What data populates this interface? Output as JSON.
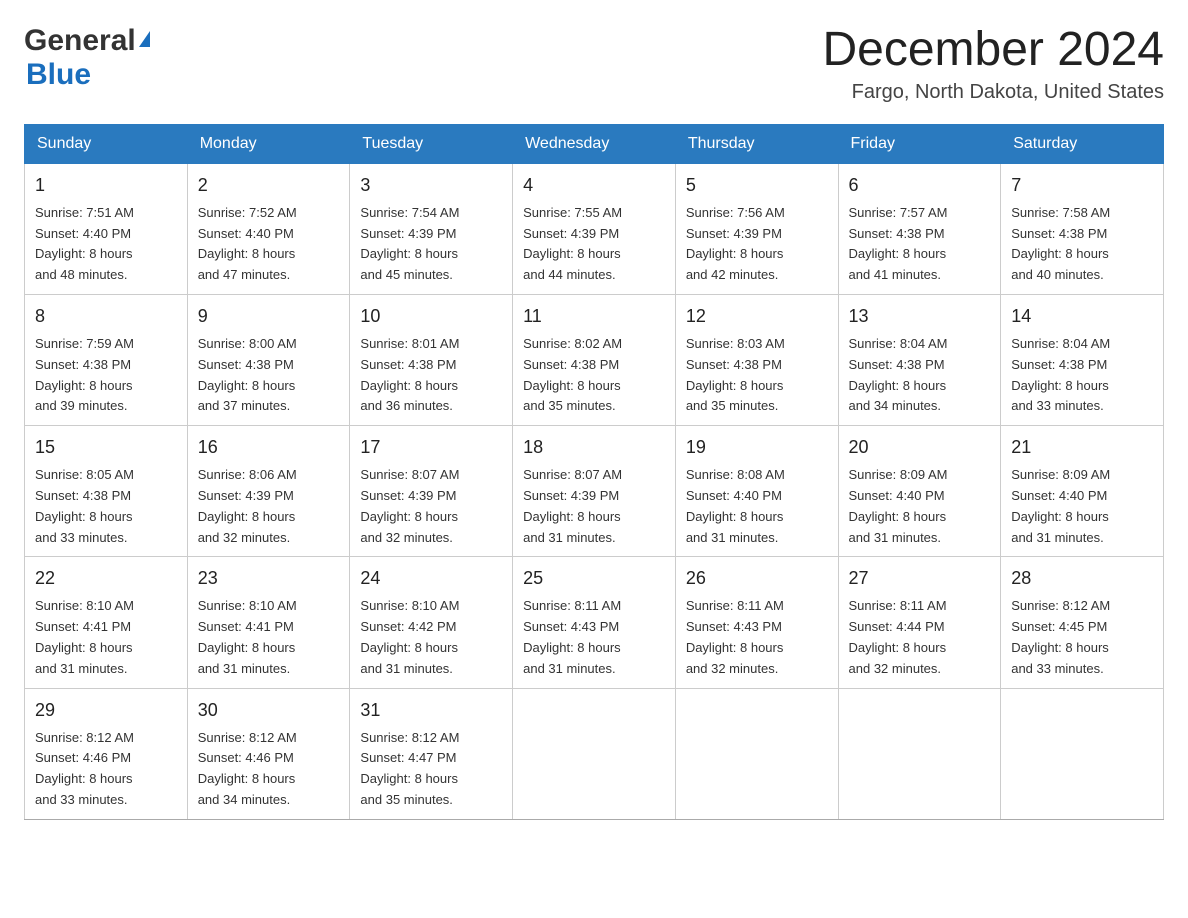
{
  "logo": {
    "text_general": "General",
    "text_blue": "Blue"
  },
  "title": "December 2024",
  "subtitle": "Fargo, North Dakota, United States",
  "days_of_week": [
    "Sunday",
    "Monday",
    "Tuesday",
    "Wednesday",
    "Thursday",
    "Friday",
    "Saturday"
  ],
  "weeks": [
    [
      {
        "day": "1",
        "sunrise": "7:51 AM",
        "sunset": "4:40 PM",
        "daylight": "8 hours and 48 minutes."
      },
      {
        "day": "2",
        "sunrise": "7:52 AM",
        "sunset": "4:40 PM",
        "daylight": "8 hours and 47 minutes."
      },
      {
        "day": "3",
        "sunrise": "7:54 AM",
        "sunset": "4:39 PM",
        "daylight": "8 hours and 45 minutes."
      },
      {
        "day": "4",
        "sunrise": "7:55 AM",
        "sunset": "4:39 PM",
        "daylight": "8 hours and 44 minutes."
      },
      {
        "day": "5",
        "sunrise": "7:56 AM",
        "sunset": "4:39 PM",
        "daylight": "8 hours and 42 minutes."
      },
      {
        "day": "6",
        "sunrise": "7:57 AM",
        "sunset": "4:38 PM",
        "daylight": "8 hours and 41 minutes."
      },
      {
        "day": "7",
        "sunrise": "7:58 AM",
        "sunset": "4:38 PM",
        "daylight": "8 hours and 40 minutes."
      }
    ],
    [
      {
        "day": "8",
        "sunrise": "7:59 AM",
        "sunset": "4:38 PM",
        "daylight": "8 hours and 39 minutes."
      },
      {
        "day": "9",
        "sunrise": "8:00 AM",
        "sunset": "4:38 PM",
        "daylight": "8 hours and 37 minutes."
      },
      {
        "day": "10",
        "sunrise": "8:01 AM",
        "sunset": "4:38 PM",
        "daylight": "8 hours and 36 minutes."
      },
      {
        "day": "11",
        "sunrise": "8:02 AM",
        "sunset": "4:38 PM",
        "daylight": "8 hours and 35 minutes."
      },
      {
        "day": "12",
        "sunrise": "8:03 AM",
        "sunset": "4:38 PM",
        "daylight": "8 hours and 35 minutes."
      },
      {
        "day": "13",
        "sunrise": "8:04 AM",
        "sunset": "4:38 PM",
        "daylight": "8 hours and 34 minutes."
      },
      {
        "day": "14",
        "sunrise": "8:04 AM",
        "sunset": "4:38 PM",
        "daylight": "8 hours and 33 minutes."
      }
    ],
    [
      {
        "day": "15",
        "sunrise": "8:05 AM",
        "sunset": "4:38 PM",
        "daylight": "8 hours and 33 minutes."
      },
      {
        "day": "16",
        "sunrise": "8:06 AM",
        "sunset": "4:39 PM",
        "daylight": "8 hours and 32 minutes."
      },
      {
        "day": "17",
        "sunrise": "8:07 AM",
        "sunset": "4:39 PM",
        "daylight": "8 hours and 32 minutes."
      },
      {
        "day": "18",
        "sunrise": "8:07 AM",
        "sunset": "4:39 PM",
        "daylight": "8 hours and 31 minutes."
      },
      {
        "day": "19",
        "sunrise": "8:08 AM",
        "sunset": "4:40 PM",
        "daylight": "8 hours and 31 minutes."
      },
      {
        "day": "20",
        "sunrise": "8:09 AM",
        "sunset": "4:40 PM",
        "daylight": "8 hours and 31 minutes."
      },
      {
        "day": "21",
        "sunrise": "8:09 AM",
        "sunset": "4:40 PM",
        "daylight": "8 hours and 31 minutes."
      }
    ],
    [
      {
        "day": "22",
        "sunrise": "8:10 AM",
        "sunset": "4:41 PM",
        "daylight": "8 hours and 31 minutes."
      },
      {
        "day": "23",
        "sunrise": "8:10 AM",
        "sunset": "4:41 PM",
        "daylight": "8 hours and 31 minutes."
      },
      {
        "day": "24",
        "sunrise": "8:10 AM",
        "sunset": "4:42 PM",
        "daylight": "8 hours and 31 minutes."
      },
      {
        "day": "25",
        "sunrise": "8:11 AM",
        "sunset": "4:43 PM",
        "daylight": "8 hours and 31 minutes."
      },
      {
        "day": "26",
        "sunrise": "8:11 AM",
        "sunset": "4:43 PM",
        "daylight": "8 hours and 32 minutes."
      },
      {
        "day": "27",
        "sunrise": "8:11 AM",
        "sunset": "4:44 PM",
        "daylight": "8 hours and 32 minutes."
      },
      {
        "day": "28",
        "sunrise": "8:12 AM",
        "sunset": "4:45 PM",
        "daylight": "8 hours and 33 minutes."
      }
    ],
    [
      {
        "day": "29",
        "sunrise": "8:12 AM",
        "sunset": "4:46 PM",
        "daylight": "8 hours and 33 minutes."
      },
      {
        "day": "30",
        "sunrise": "8:12 AM",
        "sunset": "4:46 PM",
        "daylight": "8 hours and 34 minutes."
      },
      {
        "day": "31",
        "sunrise": "8:12 AM",
        "sunset": "4:47 PM",
        "daylight": "8 hours and 35 minutes."
      },
      null,
      null,
      null,
      null
    ]
  ],
  "labels": {
    "sunrise": "Sunrise:",
    "sunset": "Sunset:",
    "daylight": "Daylight:"
  }
}
